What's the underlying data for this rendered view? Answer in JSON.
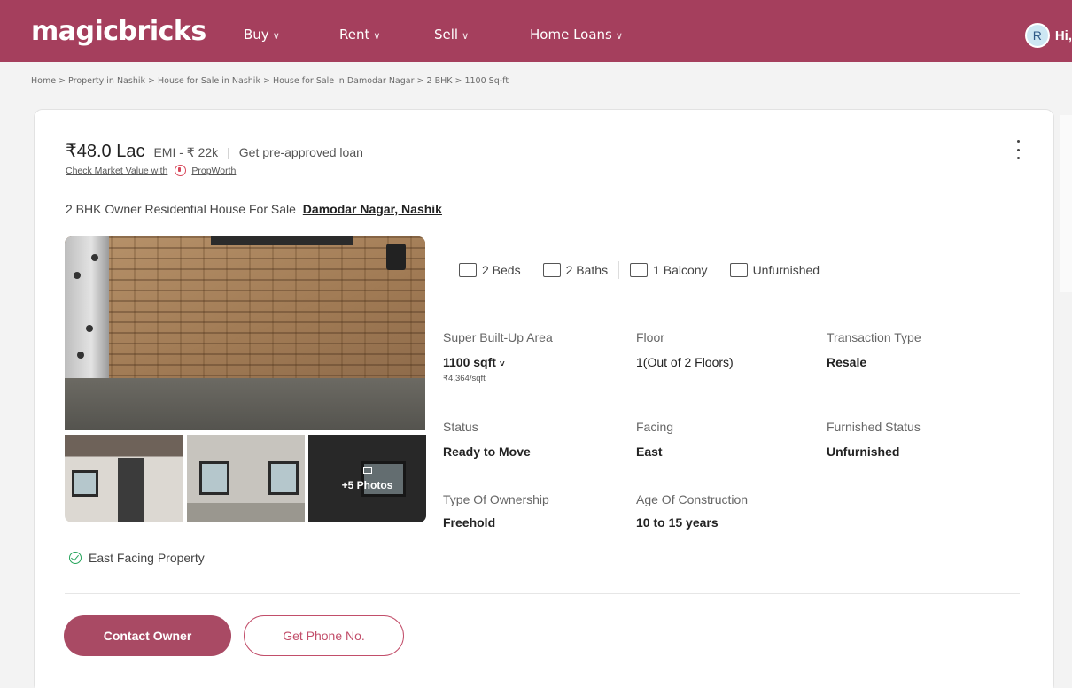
{
  "header": {
    "logo": "magicbricks",
    "nav": [
      {
        "label": "Buy"
      },
      {
        "label": "Rent"
      },
      {
        "label": "Sell"
      },
      {
        "label": "Home Loans"
      }
    ],
    "user_initial": "R",
    "greeting": "Hi,"
  },
  "breadcrumbs": "Home > Property in Nashik > House for Sale in Nashik > House for Sale in Damodar Nagar > 2 BHK > 1100 Sq-ft",
  "listing": {
    "price": "₹48.0 Lac",
    "emi": "EMI - ₹ 22k",
    "loan_link": "Get pre-approved loan",
    "market_value": "Check Market Value with",
    "propworth": "PropWorth",
    "title": "2 BHK Owner Residential House For Sale",
    "location": "Damodar Nagar, Nashik",
    "photos_more": "+5 Photos",
    "amenities": [
      "2 Beds",
      "2 Baths",
      "1 Balcony",
      "Unfurnished"
    ],
    "details": {
      "area_label": "Super Built-Up Area",
      "area_value": "1100 sqft",
      "area_rate": "₹4,364/sqft",
      "floor_label": "Floor",
      "floor_value": "1(Out of 2 Floors)",
      "transaction_label": "Transaction Type",
      "transaction_value": "Resale",
      "status_label": "Status",
      "status_value": "Ready to Move",
      "facing_label": "Facing",
      "facing_value": "East",
      "furnished_label": "Furnished Status",
      "furnished_value": "Unfurnished",
      "ownership_label": "Type Of Ownership",
      "ownership_value": "Freehold",
      "age_label": "Age Of Construction",
      "age_value": "10 to 15 years"
    },
    "highlight": "East Facing Property",
    "contact_button": "Contact Owner",
    "phone_button": "Get Phone No."
  },
  "colors": {
    "brand": "#a53f5d",
    "accent": "#c24e6a",
    "check": "#26a45b"
  }
}
